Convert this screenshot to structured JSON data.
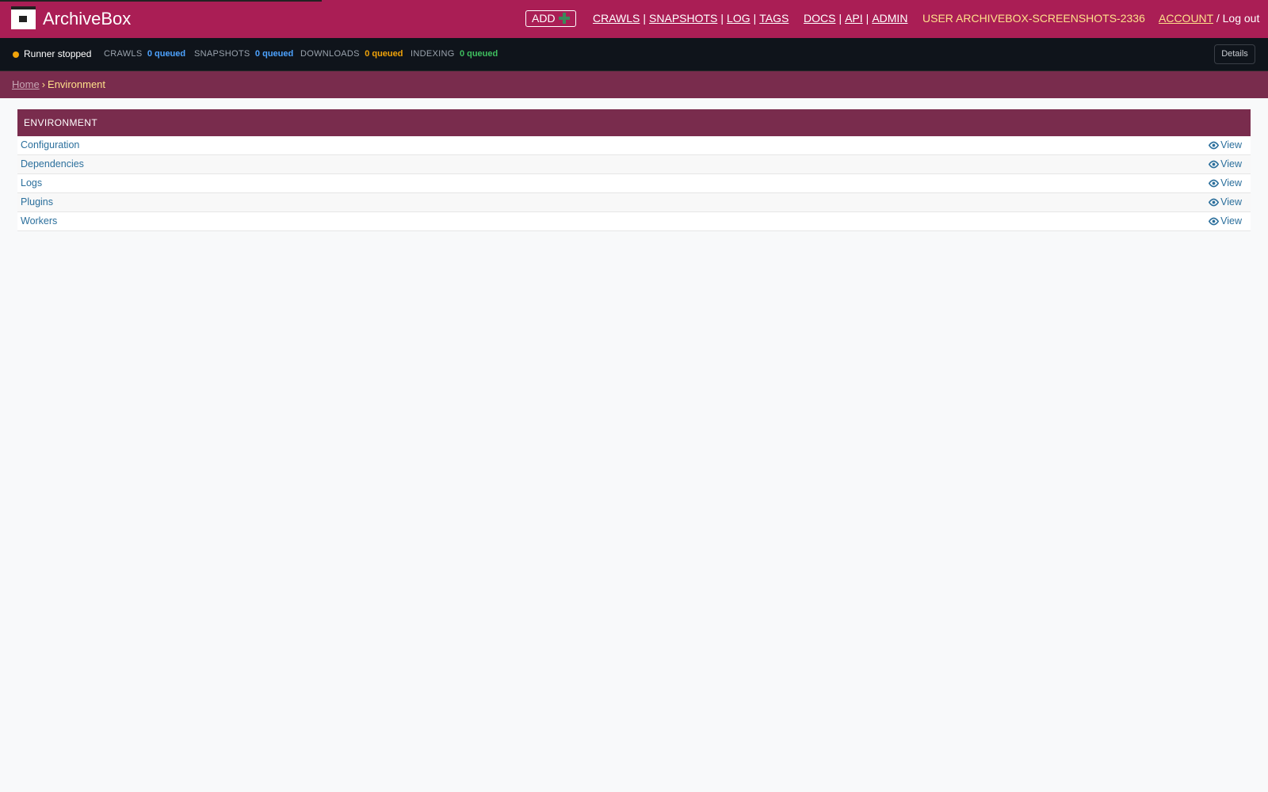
{
  "header": {
    "brand": "ArchiveBox",
    "add_label": "ADD",
    "nav_primary": [
      "CRAWLS",
      "SNAPSHOTS",
      "LOG",
      "TAGS"
    ],
    "nav_secondary": [
      "DOCS",
      "API",
      "ADMIN"
    ],
    "user_label": "USER ARCHIVEBOX-SCREENSHOTS-2336",
    "account_label": "ACCOUNT",
    "account_sep": "/",
    "logout_label": "Log out"
  },
  "status": {
    "runner": "Runner stopped",
    "crawls_label": "CRAWLS",
    "crawls_value": "0 queued",
    "snapshots_label": "SNAPSHOTS",
    "snapshots_value": "0 queued",
    "downloads_label": "DOWNLOADS",
    "downloads_value": "0 queued",
    "indexing_label": "INDEXING",
    "indexing_value": "0 queued",
    "details_label": "Details",
    "colors": {
      "runner_dot": "#f0a30a",
      "crawls": "#4da3ff",
      "snapshots": "#4da3ff",
      "downloads": "#f0a30a",
      "indexing": "#3fbf5f"
    }
  },
  "breadcrumb": {
    "home": "Home",
    "separator": "›",
    "current": "Environment"
  },
  "module": {
    "title": "ENVIRONMENT",
    "view_label": "View",
    "rows": [
      {
        "name": "Configuration"
      },
      {
        "name": "Dependencies"
      },
      {
        "name": "Logs"
      },
      {
        "name": "Plugins"
      },
      {
        "name": "Workers"
      }
    ]
  },
  "colors": {
    "header_bg": "#aa1e55",
    "breadcrumb_bg": "#792c4d",
    "statusbar_bg": "#0f141b",
    "link": "#2b6f9c"
  }
}
